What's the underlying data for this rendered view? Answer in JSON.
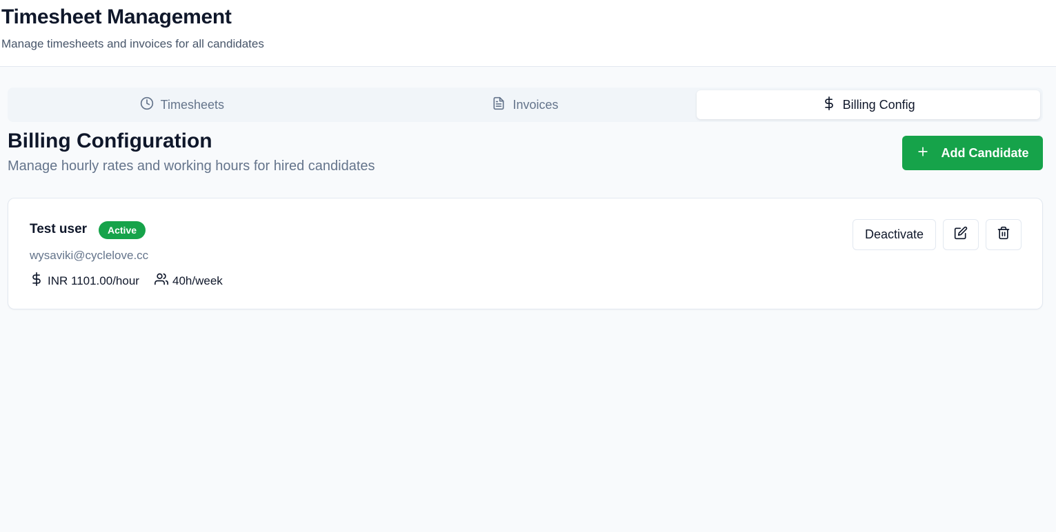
{
  "header": {
    "title": "Timesheet Management",
    "subtitle": "Manage timesheets and invoices for all candidates"
  },
  "tabs": [
    {
      "label": "Timesheets",
      "icon": "clock-icon",
      "active": false
    },
    {
      "label": "Invoices",
      "icon": "file-text-icon",
      "active": false
    },
    {
      "label": "Billing Config",
      "icon": "dollar-sign-icon",
      "active": true
    }
  ],
  "section": {
    "title": "Billing Configuration",
    "subtitle": "Manage hourly rates and working hours for hired candidates",
    "add_button_label": "Add Candidate",
    "add_button_icon": "plus-icon"
  },
  "candidates": [
    {
      "name": "Test user",
      "status": "Active",
      "email": "wysaviki@cyclelove.cc",
      "rate": "INR 1101.00/hour",
      "hours": "40h/week",
      "deactivate_label": "Deactivate"
    }
  ],
  "colors": {
    "accent": "#16a34a",
    "text": "#0f172a",
    "muted": "#64748b",
    "border": "#e2e8f0",
    "background": "#f8fafc"
  }
}
